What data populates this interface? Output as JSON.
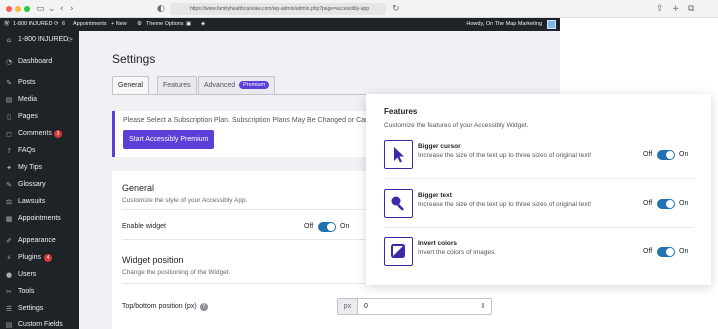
{
  "browser": {
    "url": "https://www.familyhealthcarelaw.com/wp-admin/admin.php?page=accessibly-app"
  },
  "admin_bar": {
    "site_name": "1-800 INJURED",
    "updates_count": "6",
    "appointments": "Appointments",
    "new_label": "+ New",
    "theme_options": "Theme Options",
    "greeting": "Howdy, On The Map Marketing"
  },
  "sidebar": {
    "items": [
      {
        "label": "1-800 INJURED",
        "icon": "home-icon"
      },
      {
        "label": "Dashboard",
        "icon": "dashboard-icon"
      },
      {
        "label": "Posts",
        "icon": "pin-icon"
      },
      {
        "label": "Media",
        "icon": "media-icon"
      },
      {
        "label": "Pages",
        "icon": "page-icon"
      },
      {
        "label": "Comments",
        "icon": "comment-icon",
        "badge": "3"
      },
      {
        "label": "FAQs",
        "icon": "faq-icon"
      },
      {
        "label": "My Tips",
        "icon": "tips-icon"
      },
      {
        "label": "Glossary",
        "icon": "glossary-icon"
      },
      {
        "label": "Lawsuits",
        "icon": "lawsuit-icon"
      },
      {
        "label": "Appointments",
        "icon": "calendar-icon"
      },
      {
        "label": "Appearance",
        "icon": "brush-icon"
      },
      {
        "label": "Plugins",
        "icon": "plugin-icon",
        "badge": "4"
      },
      {
        "label": "Users",
        "icon": "user-icon"
      },
      {
        "label": "Tools",
        "icon": "wrench-icon"
      },
      {
        "label": "Settings",
        "icon": "settings-icon"
      },
      {
        "label": "Custom Fields",
        "icon": "fields-icon"
      }
    ]
  },
  "main": {
    "title": "Settings",
    "tabs": [
      {
        "label": "General",
        "active": true
      },
      {
        "label": "Features",
        "active": false
      },
      {
        "label": "Advanced",
        "active": false,
        "pill": "Premium"
      }
    ],
    "notice": {
      "text": "Please Select a Subscription Plan. Subscription Plans May Be Changed or Can",
      "button": "Start Accessibly Premium"
    },
    "general": {
      "heading": "General",
      "subtitle": "Customize the style of your Accessibly App.",
      "enable_widget_label": "Enable widget",
      "toggle_off": "Off",
      "toggle_on": "On",
      "enabled": true
    },
    "widget_position": {
      "heading": "Widget position",
      "subtitle": "Change the positioning of the Widget.",
      "top_bottom_label": "Top/bottom position (px)",
      "help": "?",
      "unit": "px",
      "value": "0"
    }
  },
  "features_panel": {
    "title": "Features",
    "subtitle": "Customize the features of your Accessibly Widget.",
    "toggle_off": "Off",
    "toggle_on": "On",
    "items": [
      {
        "name": "Bigger cursor",
        "description": "Increase the size of the text up to three sizes of original text!",
        "icon": "cursor-icon",
        "enabled": true
      },
      {
        "name": "Bigger text",
        "description": "Increase the size of the text up to three sizes of original text!",
        "icon": "magnify-icon",
        "enabled": true
      },
      {
        "name": "Invert colors",
        "description": "Invert the colors of images.",
        "icon": "invert-icon",
        "enabled": true
      }
    ]
  },
  "colors": {
    "accent": "#5b3fd8",
    "toggle_on": "#2271b1",
    "admin_dark": "#1d2327"
  }
}
